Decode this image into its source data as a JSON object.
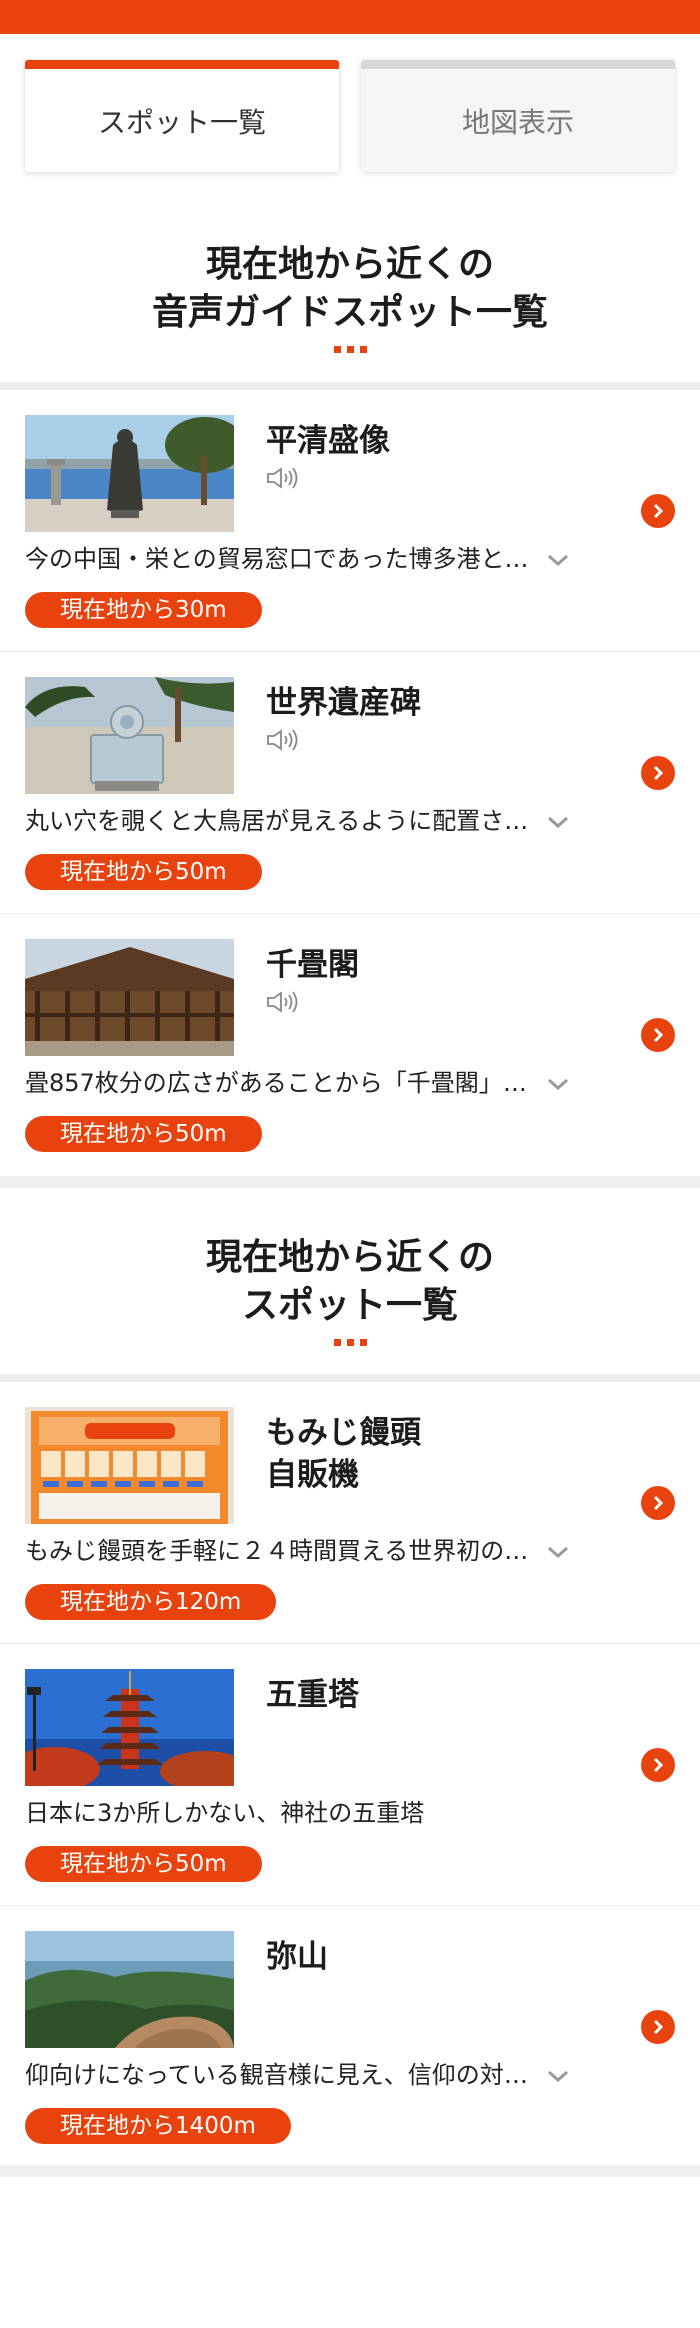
{
  "colors": {
    "accent": "#e8430f",
    "divider": "#efefef"
  },
  "tabs": [
    {
      "label": "スポット一覧",
      "active": true
    },
    {
      "label": "地図表示",
      "active": false
    }
  ],
  "sections": [
    {
      "title_line1": "現在地から近くの",
      "title_line2": "音声ガイドスポット一覧",
      "spots": [
        {
          "name": "平清盛像",
          "name_line2": "",
          "audio": true,
          "description": "今の中国・栄との貿易窓口であった博多港と一緒に…",
          "distance": "現在地から30m",
          "expandable": true,
          "image": "statue-by-sea"
        },
        {
          "name": "世界遺産碑",
          "name_line2": "",
          "audio": true,
          "description": "丸い穴を覗くと大鳥居が見えるように配置されて…",
          "distance": "現在地から50m",
          "expandable": true,
          "image": "monument-on-beach"
        },
        {
          "name": "千畳閣",
          "name_line2": "",
          "audio": true,
          "description": "畳857枚分の広さがあることから「千畳閣」と呼ばれ…",
          "distance": "現在地から50m",
          "expandable": true,
          "image": "wooden-hall"
        }
      ]
    },
    {
      "title_line1": "現在地から近くの",
      "title_line2": "スポット一覧",
      "spots": [
        {
          "name": "もみじ饅頭",
          "name_line2": "自販機",
          "audio": false,
          "description": "もみじ饅頭を手軽に２４時間買える世界初の自販機…",
          "distance": "現在地から120m",
          "expandable": true,
          "image": "vending-machine"
        },
        {
          "name": "五重塔",
          "name_line2": "",
          "audio": false,
          "description": "日本に3か所しかない、神社の五重塔",
          "distance": "現在地から50m",
          "expandable": false,
          "image": "five-story-pagoda"
        },
        {
          "name": "弥山",
          "name_line2": "",
          "audio": false,
          "description": "仰向けになっている観音様に見え、信仰の対象とさ…",
          "distance": "現在地から1400m",
          "expandable": true,
          "image": "mountain-view"
        }
      ]
    }
  ]
}
